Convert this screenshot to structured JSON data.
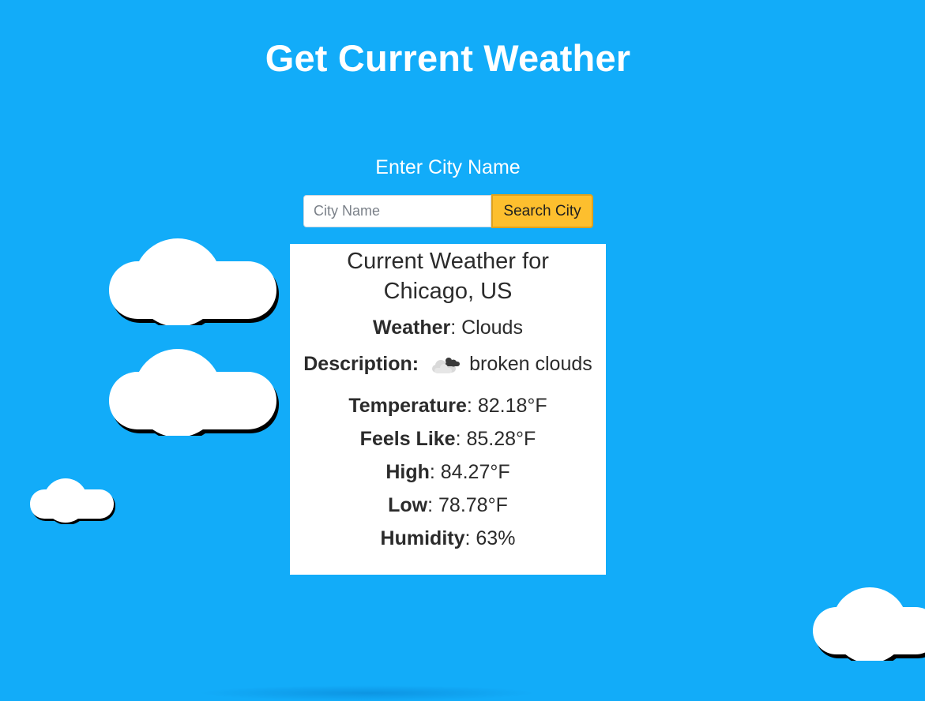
{
  "header": {
    "title": "Get Current Weather"
  },
  "search": {
    "label": "Enter City Name",
    "placeholder": "City Name",
    "value": "",
    "button_label": "Search City"
  },
  "weather": {
    "heading_line1": "Current Weather for",
    "heading_line2": "Chicago, US",
    "weather_label": "Weather",
    "weather_value": ": Clouds",
    "description_label": "Description:",
    "description_icon": "broken-clouds-icon",
    "description_value": "broken clouds",
    "temperature_label": "Temperature",
    "temperature_value": ": 82.18°F",
    "feels_like_label": "Feels Like",
    "feels_like_value": ": 85.28°F",
    "high_label": "High",
    "high_value": ": 84.27°F",
    "low_label": "Low",
    "low_value": ": 78.78°F",
    "humidity_label": "Humidity",
    "humidity_value": ": 63%"
  },
  "colors": {
    "background": "#12acf9",
    "button": "#fdbf2e",
    "card": "#ffffff",
    "cloud": "#ffffff"
  }
}
